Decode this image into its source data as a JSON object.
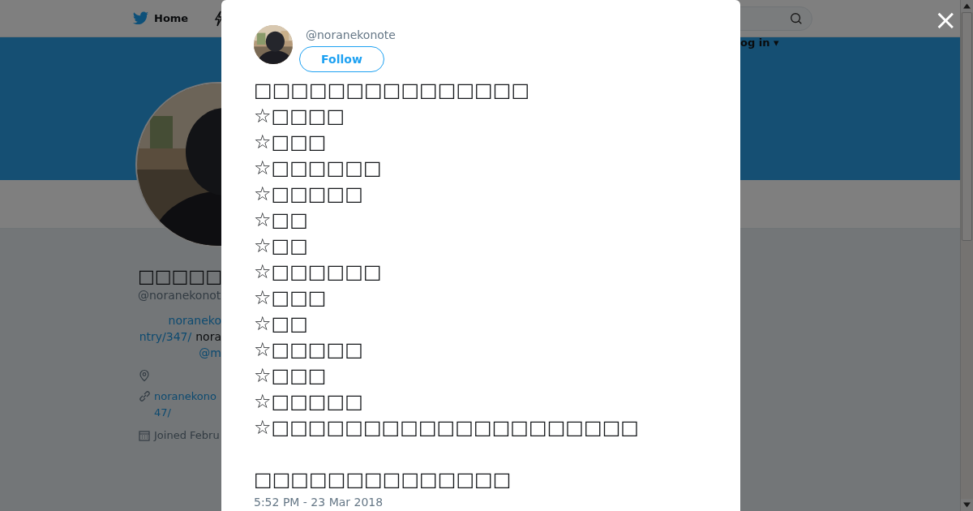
{
  "background_page": {
    "nav": {
      "home_label": "Home",
      "login_label": "og in ▾"
    },
    "profile": {
      "avatar": {
        "kind": "picture"
      },
      "name": "□□□□□",
      "handle": "@noranekonot",
      "bio_lines": [
        [
          {
            "kind": "link",
            "text": "noraneko"
          }
        ],
        [
          {
            "kind": "link",
            "text": "ntry/347/"
          },
          {
            "kind": "text",
            "text": "nora"
          }
        ],
        [
          {
            "kind": "link",
            "text": "@m"
          }
        ]
      ],
      "url_lines": [
        "noranekono",
        "47/"
      ],
      "joined": "Joined Febru"
    }
  },
  "modal": {
    "author": {
      "avatar": {
        "kind": "picture"
      },
      "handle": "@noranekonote"
    },
    "follow_button": "Follow",
    "tweet_paragraphs": [
      [
        "□□□□□□□□□□□□□□□",
        "☆□□□□",
        "☆□□□",
        "☆□□□□□□",
        "☆□□□□□",
        "☆□□",
        "☆□□",
        "☆□□□□□□",
        "☆□□□",
        "☆□□",
        "☆□□□□□",
        "☆□□□",
        "☆□□□□□",
        "☆□□□□□□□□□□□□□□□□□□□□"
      ],
      [
        "□□□□□□□□□□□□□□"
      ]
    ],
    "timestamp": "5:52 PM - 23 Mar 2018",
    "close_label": "×"
  }
}
